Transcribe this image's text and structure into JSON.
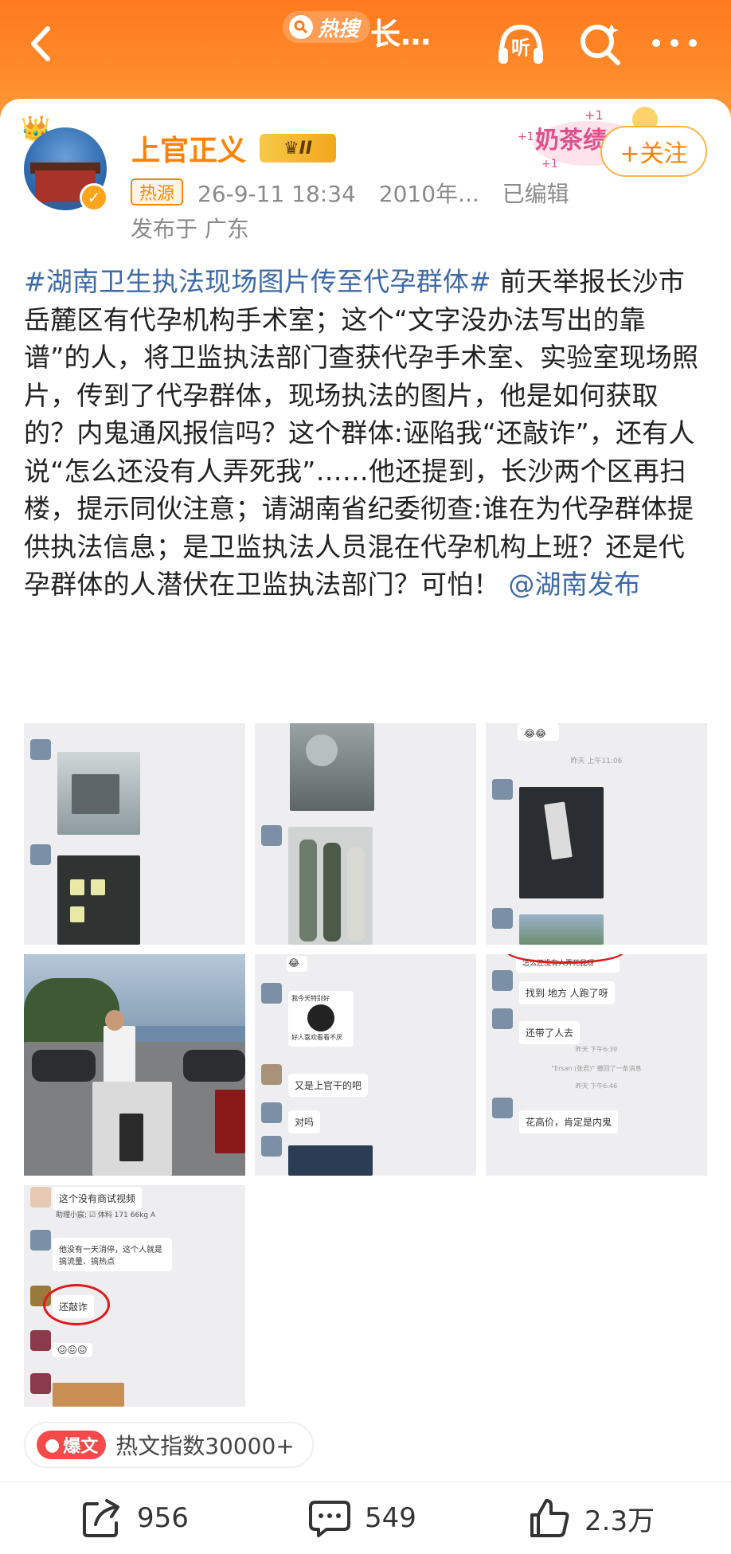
{
  "topbar": {
    "hot_label": "热搜",
    "title": "长…",
    "listen_label": "听"
  },
  "user": {
    "name": "上官正义",
    "vip_level": "II",
    "hot_source": "热源",
    "date": "26-9-11 18:34",
    "device": "2010年...",
    "edited": "已编辑",
    "location": "发布于 广东",
    "follow_label": "+关注",
    "sticker_text": "奶茶绩",
    "sticker_plus": "+1"
  },
  "post": {
    "tag": "#湖南卫生执法现场图片传至代孕群体#",
    "body": " 前天举报长沙市岳麓区有代孕机构手术室；这个“文字没办法写出的靠谱”的人，将卫监执法部门查获代孕手术室、实验室现场照片，传到了代孕群体，现场执法的图片，他是如何获取的？内鬼通风报信吗？这个群体:诬陷我“还敲诈”，还有人说“怎么还没有人弄死我”……他还提到，长沙两个区再扫楼，提示同伙注意；请湖南省纪委彻查:谁在为代孕群体提供执法信息；是卫监执法人员混在代孕机构上班？还是代孕群体的人潜伏在卫监执法部门？可怕！",
    "mention": "@湖南发布"
  },
  "thumbs": {
    "t3_time": "昨天 上午11:06",
    "t5_meme": "我今天特别好",
    "t5_meme2": "好人喜欢看看不厌",
    "t5_b1": "又是上官干的吧",
    "t5_b2": "对吗",
    "t6_top": "怎么还没有人弄死我呀",
    "t6_b1": "找到 地方 人跑了呀",
    "t6_b2": "还带了人去",
    "t6_time1": "昨天 下午6:39",
    "t6_sys": "\"Ersan (张君)\" 撤回了一条消息",
    "t6_time2": "昨天 下午6:46",
    "t6_b3": "花高价，肯定是内鬼",
    "t7_b1": "这个没有商试视频",
    "t7_b2": "他没有一天消停，这个人就是搞流量、搞热点",
    "t7_b3": "还敲诈",
    "t7_note": "助理小宸: ☑ 体料 171 66kg A"
  },
  "hot_index": {
    "badge": "爆文",
    "text": "热文指数30000+"
  },
  "actions": {
    "share": "956",
    "comment": "549",
    "like": "2.3万"
  }
}
